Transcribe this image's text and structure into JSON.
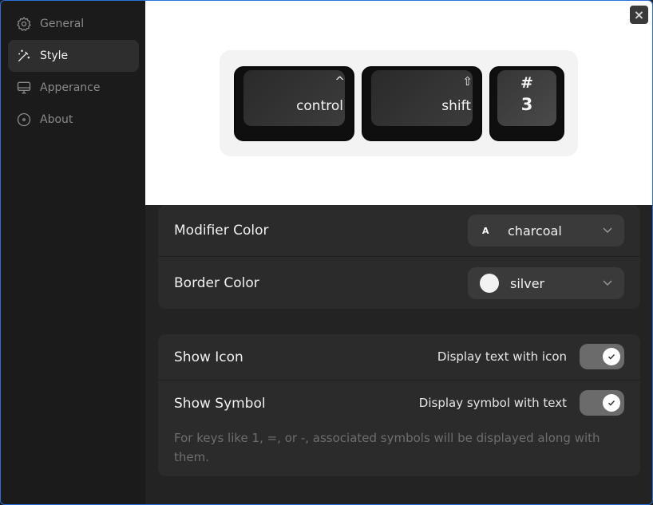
{
  "sidebar": {
    "items": [
      {
        "label": "General",
        "icon": "gear-icon"
      },
      {
        "label": "Style",
        "icon": "magic-wand-icon"
      },
      {
        "label": "Apperance",
        "icon": "monitor-icon"
      },
      {
        "label": "About",
        "icon": "disc-icon"
      }
    ],
    "active_index": 1
  },
  "preview": {
    "close_label": "×",
    "keys": [
      {
        "symbol": "^",
        "label": "control"
      },
      {
        "symbol": "⇧",
        "label": "shift"
      },
      {
        "symbol": "#",
        "label": "3"
      }
    ]
  },
  "colors": {
    "modifier": {
      "label": "Modifier Color",
      "badge": "A",
      "value": "charcoal"
    },
    "border": {
      "label": "Border Color",
      "value": "silver",
      "swatch": "#f2f2f2"
    }
  },
  "display": {
    "show_icon": {
      "label": "Show Icon",
      "hint": "Display text with icon",
      "enabled": true
    },
    "show_symbol": {
      "label": "Show Symbol",
      "hint": "Display symbol with text",
      "enabled": true
    },
    "note": "For keys like 1, =, or -, associated symbols will be displayed along with them."
  },
  "theme": {
    "accent": "#2a6fdb",
    "sidebar_bg": "#1b1b1b",
    "card_bg": "#2b2b2b"
  }
}
